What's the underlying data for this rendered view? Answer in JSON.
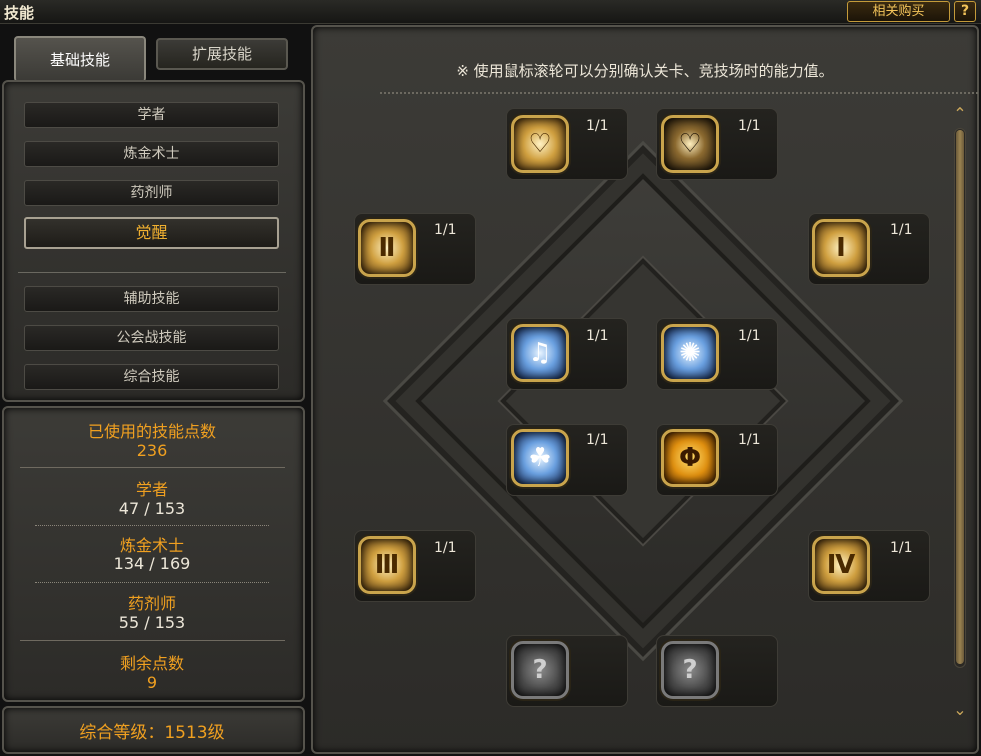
{
  "window": {
    "title": "技能",
    "buy_label": "相关购买",
    "help_label": "?"
  },
  "tabs": {
    "basic": "基础技能",
    "extended": "扩展技能"
  },
  "classes": [
    "学者",
    "炼金术士",
    "药剂师",
    "觉醒"
  ],
  "extra_categories": [
    "辅助技能",
    "公会战技能",
    "综合技能"
  ],
  "stats": {
    "used_label": "已使用的技能点数",
    "used_value": "236",
    "scholar_label": "学者",
    "scholar_value": "47 / 153",
    "alchemist_label": "炼金术士",
    "alchemist_value": "134 / 169",
    "pharmacist_label": "药剂师",
    "pharmacist_value": "55 / 153",
    "remaining_label": "剩余点数",
    "remaining_value": "9"
  },
  "overall_level": "综合等级：1513级",
  "notice": "※ 使用鼠标滚轮可以分别确认关卡、竞技场时的能力值。",
  "skills": {
    "top_left": {
      "level": "1/1",
      "icon": "heart-icon"
    },
    "top_right": {
      "level": "1/1",
      "icon": "heart-shield-icon"
    },
    "mid_left": {
      "level": "1/1",
      "icon": "roman-2-icon",
      "glyph": "Ⅱ"
    },
    "mid_right": {
      "level": "1/1",
      "icon": "roman-1-icon",
      "glyph": "Ⅰ"
    },
    "inner_tl": {
      "level": "1/1",
      "icon": "water-splash-icon"
    },
    "inner_tr": {
      "level": "1/1",
      "icon": "bubbles-icon"
    },
    "inner_bl": {
      "level": "1/1",
      "icon": "bubble-burst-icon"
    },
    "inner_br": {
      "level": "1/1",
      "icon": "golden-emblem-icon"
    },
    "low_left": {
      "level": "1/1",
      "icon": "roman-3-icon",
      "glyph": "Ⅲ"
    },
    "low_right": {
      "level": "1/1",
      "icon": "roman-4-icon",
      "glyph": "Ⅳ"
    },
    "locked": {
      "glyph": "?"
    }
  }
}
